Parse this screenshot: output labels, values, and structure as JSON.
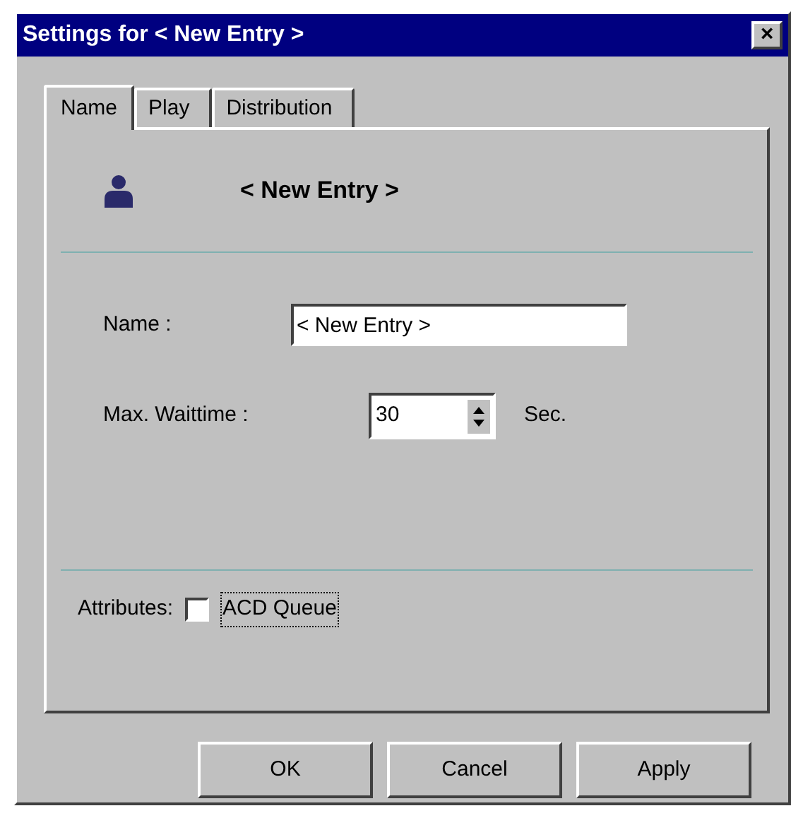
{
  "window": {
    "title": "Settings for < New Entry >",
    "close": "×"
  },
  "tabs": [
    {
      "label": "Name",
      "selected": true
    },
    {
      "label": "Play",
      "selected": false
    },
    {
      "label": "Distribution",
      "selected": false
    }
  ],
  "heading": "< New Entry >",
  "name_field": {
    "label": "Name :",
    "value": "< New Entry >"
  },
  "wait_field": {
    "label": "Max. Waittime :",
    "value": "30",
    "unit": "Sec."
  },
  "attributes": {
    "label": "Attributes:",
    "option": {
      "label": "ACD Queue",
      "checked": false,
      "focused": true
    }
  },
  "buttons": [
    "OK",
    "Cancel",
    "Apply"
  ]
}
